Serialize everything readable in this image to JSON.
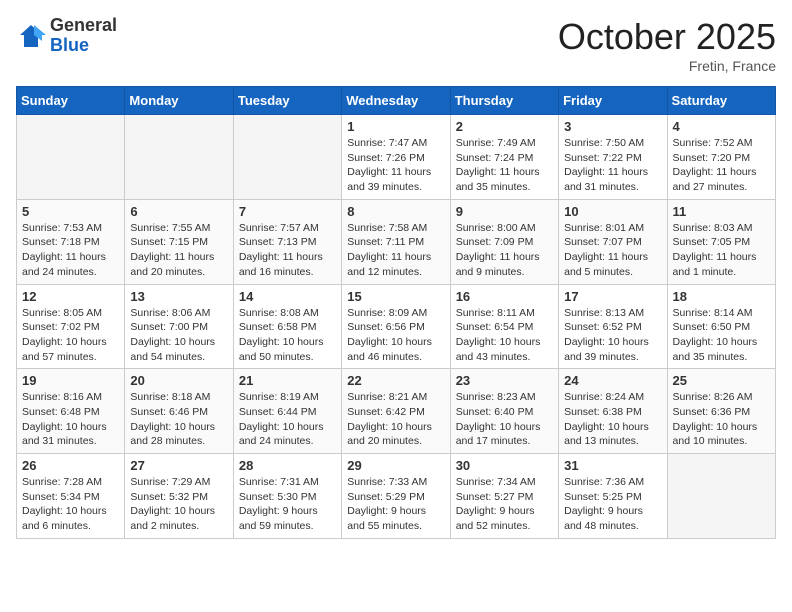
{
  "header": {
    "logo_general": "General",
    "logo_blue": "Blue",
    "month": "October 2025",
    "location": "Fretin, France"
  },
  "weekdays": [
    "Sunday",
    "Monday",
    "Tuesday",
    "Wednesday",
    "Thursday",
    "Friday",
    "Saturday"
  ],
  "weeks": [
    [
      {
        "day": "",
        "sunrise": "",
        "sunset": "",
        "daylight": ""
      },
      {
        "day": "",
        "sunrise": "",
        "sunset": "",
        "daylight": ""
      },
      {
        "day": "",
        "sunrise": "",
        "sunset": "",
        "daylight": ""
      },
      {
        "day": "1",
        "sunrise": "Sunrise: 7:47 AM",
        "sunset": "Sunset: 7:26 PM",
        "daylight": "Daylight: 11 hours and 39 minutes."
      },
      {
        "day": "2",
        "sunrise": "Sunrise: 7:49 AM",
        "sunset": "Sunset: 7:24 PM",
        "daylight": "Daylight: 11 hours and 35 minutes."
      },
      {
        "day": "3",
        "sunrise": "Sunrise: 7:50 AM",
        "sunset": "Sunset: 7:22 PM",
        "daylight": "Daylight: 11 hours and 31 minutes."
      },
      {
        "day": "4",
        "sunrise": "Sunrise: 7:52 AM",
        "sunset": "Sunset: 7:20 PM",
        "daylight": "Daylight: 11 hours and 27 minutes."
      }
    ],
    [
      {
        "day": "5",
        "sunrise": "Sunrise: 7:53 AM",
        "sunset": "Sunset: 7:18 PM",
        "daylight": "Daylight: 11 hours and 24 minutes."
      },
      {
        "day": "6",
        "sunrise": "Sunrise: 7:55 AM",
        "sunset": "Sunset: 7:15 PM",
        "daylight": "Daylight: 11 hours and 20 minutes."
      },
      {
        "day": "7",
        "sunrise": "Sunrise: 7:57 AM",
        "sunset": "Sunset: 7:13 PM",
        "daylight": "Daylight: 11 hours and 16 minutes."
      },
      {
        "day": "8",
        "sunrise": "Sunrise: 7:58 AM",
        "sunset": "Sunset: 7:11 PM",
        "daylight": "Daylight: 11 hours and 12 minutes."
      },
      {
        "day": "9",
        "sunrise": "Sunrise: 8:00 AM",
        "sunset": "Sunset: 7:09 PM",
        "daylight": "Daylight: 11 hours and 9 minutes."
      },
      {
        "day": "10",
        "sunrise": "Sunrise: 8:01 AM",
        "sunset": "Sunset: 7:07 PM",
        "daylight": "Daylight: 11 hours and 5 minutes."
      },
      {
        "day": "11",
        "sunrise": "Sunrise: 8:03 AM",
        "sunset": "Sunset: 7:05 PM",
        "daylight": "Daylight: 11 hours and 1 minute."
      }
    ],
    [
      {
        "day": "12",
        "sunrise": "Sunrise: 8:05 AM",
        "sunset": "Sunset: 7:02 PM",
        "daylight": "Daylight: 10 hours and 57 minutes."
      },
      {
        "day": "13",
        "sunrise": "Sunrise: 8:06 AM",
        "sunset": "Sunset: 7:00 PM",
        "daylight": "Daylight: 10 hours and 54 minutes."
      },
      {
        "day": "14",
        "sunrise": "Sunrise: 8:08 AM",
        "sunset": "Sunset: 6:58 PM",
        "daylight": "Daylight: 10 hours and 50 minutes."
      },
      {
        "day": "15",
        "sunrise": "Sunrise: 8:09 AM",
        "sunset": "Sunset: 6:56 PM",
        "daylight": "Daylight: 10 hours and 46 minutes."
      },
      {
        "day": "16",
        "sunrise": "Sunrise: 8:11 AM",
        "sunset": "Sunset: 6:54 PM",
        "daylight": "Daylight: 10 hours and 43 minutes."
      },
      {
        "day": "17",
        "sunrise": "Sunrise: 8:13 AM",
        "sunset": "Sunset: 6:52 PM",
        "daylight": "Daylight: 10 hours and 39 minutes."
      },
      {
        "day": "18",
        "sunrise": "Sunrise: 8:14 AM",
        "sunset": "Sunset: 6:50 PM",
        "daylight": "Daylight: 10 hours and 35 minutes."
      }
    ],
    [
      {
        "day": "19",
        "sunrise": "Sunrise: 8:16 AM",
        "sunset": "Sunset: 6:48 PM",
        "daylight": "Daylight: 10 hours and 31 minutes."
      },
      {
        "day": "20",
        "sunrise": "Sunrise: 8:18 AM",
        "sunset": "Sunset: 6:46 PM",
        "daylight": "Daylight: 10 hours and 28 minutes."
      },
      {
        "day": "21",
        "sunrise": "Sunrise: 8:19 AM",
        "sunset": "Sunset: 6:44 PM",
        "daylight": "Daylight: 10 hours and 24 minutes."
      },
      {
        "day": "22",
        "sunrise": "Sunrise: 8:21 AM",
        "sunset": "Sunset: 6:42 PM",
        "daylight": "Daylight: 10 hours and 20 minutes."
      },
      {
        "day": "23",
        "sunrise": "Sunrise: 8:23 AM",
        "sunset": "Sunset: 6:40 PM",
        "daylight": "Daylight: 10 hours and 17 minutes."
      },
      {
        "day": "24",
        "sunrise": "Sunrise: 8:24 AM",
        "sunset": "Sunset: 6:38 PM",
        "daylight": "Daylight: 10 hours and 13 minutes."
      },
      {
        "day": "25",
        "sunrise": "Sunrise: 8:26 AM",
        "sunset": "Sunset: 6:36 PM",
        "daylight": "Daylight: 10 hours and 10 minutes."
      }
    ],
    [
      {
        "day": "26",
        "sunrise": "Sunrise: 7:28 AM",
        "sunset": "Sunset: 5:34 PM",
        "daylight": "Daylight: 10 hours and 6 minutes."
      },
      {
        "day": "27",
        "sunrise": "Sunrise: 7:29 AM",
        "sunset": "Sunset: 5:32 PM",
        "daylight": "Daylight: 10 hours and 2 minutes."
      },
      {
        "day": "28",
        "sunrise": "Sunrise: 7:31 AM",
        "sunset": "Sunset: 5:30 PM",
        "daylight": "Daylight: 9 hours and 59 minutes."
      },
      {
        "day": "29",
        "sunrise": "Sunrise: 7:33 AM",
        "sunset": "Sunset: 5:29 PM",
        "daylight": "Daylight: 9 hours and 55 minutes."
      },
      {
        "day": "30",
        "sunrise": "Sunrise: 7:34 AM",
        "sunset": "Sunset: 5:27 PM",
        "daylight": "Daylight: 9 hours and 52 minutes."
      },
      {
        "day": "31",
        "sunrise": "Sunrise: 7:36 AM",
        "sunset": "Sunset: 5:25 PM",
        "daylight": "Daylight: 9 hours and 48 minutes."
      },
      {
        "day": "",
        "sunrise": "",
        "sunset": "",
        "daylight": ""
      }
    ]
  ]
}
